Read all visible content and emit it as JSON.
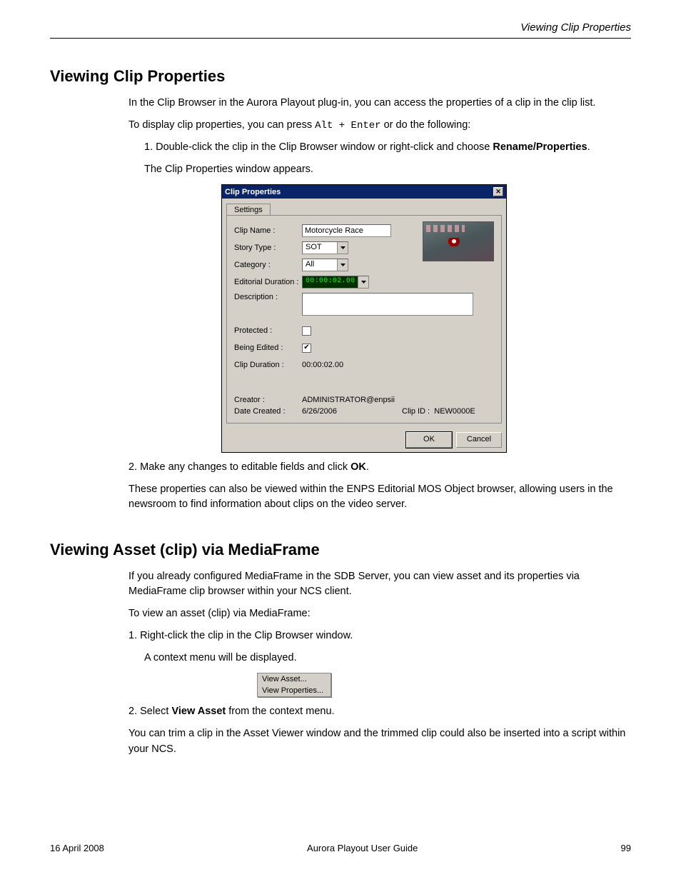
{
  "header": {
    "right_text": "Viewing Clip Properties"
  },
  "section": {
    "title": "Viewing Clip Properties",
    "para1": "In the Clip Browser in the Aurora Playout plug-in, you can access the properties of a clip in the clip list.",
    "para2_lead": "To display clip properties, you can press ",
    "para2_key": "Alt + Enter",
    "para2_tail": " or do the following:",
    "step1_prefix": "1. Double-click the clip in the Clip Browser window or right-click and choose ",
    "step1_bold": "Rename/Properties",
    "step1_suffix": ".",
    "step1_result": "The Clip Properties window appears.",
    "step2_prefix": "2. Make any changes to editable fields and click ",
    "step2_bold": "OK",
    "step2_suffix": ".",
    "para3": "These properties can also be viewed within the ENPS Editorial MOS Object browser, allowing users in the newsroom to find information about clips on the video server."
  },
  "dialog": {
    "title": "Clip Properties",
    "tab": "Settings",
    "labels": {
      "clip_name": "Clip Name :",
      "story_type": "Story Type :",
      "category": "Category :",
      "editorial_duration": "Editorial Duration :",
      "description": "Description :",
      "protected": "Protected :",
      "being_edited": "Being Edited :",
      "clip_duration": "Clip Duration :",
      "creator": "Creator :",
      "date_created": "Date Created :",
      "clip_id": "Clip ID :"
    },
    "values": {
      "clip_name": "Motorcycle Race",
      "story_type": "SOT",
      "category": "All",
      "editorial_duration": "00:00:02.00",
      "description": "",
      "protected": false,
      "being_edited": true,
      "clip_duration": "00:00:02.00",
      "creator": "ADMINISTRATOR@enpsii",
      "date_created": "6/26/2006",
      "clip_id": "NEW0000E"
    },
    "buttons": {
      "ok": "OK",
      "cancel": "Cancel"
    }
  },
  "section2": {
    "title": "Viewing Asset (clip) via MediaFrame",
    "para1": "If you already configured MediaFrame in the SDB Server, you can view asset and its properties via MediaFrame clip browser within your NCS client.",
    "lead_in": "To view an asset (clip) via MediaFrame:",
    "step1": "1. Right-click the clip in the Clip Browser window.",
    "step1_result": "A context menu will be displayed.",
    "step2_prefix": "2. Select ",
    "step2_bold": "View Asset",
    "step2_suffix": " from the context menu.",
    "footnote": "You can trim a clip in the Asset Viewer window and the trimmed clip could also be inserted into a script within your NCS."
  },
  "context_menu": {
    "items": [
      "View Asset...",
      "View Properties..."
    ]
  },
  "footer": {
    "left": "16 April 2008",
    "center": "Aurora Playout User Guide",
    "right": "99"
  }
}
